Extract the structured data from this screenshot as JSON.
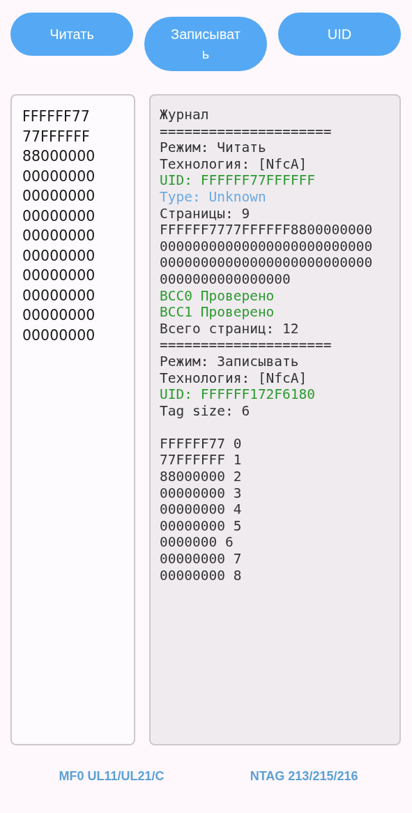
{
  "buttons": [
    {
      "label": "Читать"
    },
    {
      "label": "Записывать"
    },
    {
      "label": "UID"
    }
  ],
  "hex_field": {
    "lines": [
      "FFFFFF77",
      "77FFFFFF",
      "88000000",
      "00000000",
      "00000000",
      "00000000",
      "00000000",
      "00000000",
      "00000000",
      "00000000",
      "00000000",
      "00000000"
    ]
  },
  "log": [
    {
      "kind": "plain",
      "text": "Журнал"
    },
    {
      "kind": "plain",
      "text": "====================="
    },
    {
      "kind": "plain",
      "text": "Режим: Читать"
    },
    {
      "kind": "plain",
      "text": "Технология: [NfcA]"
    },
    {
      "kind": "success",
      "text": "UID: FFFFFF77FFFFFF"
    },
    {
      "kind": "info",
      "text": "Type: Unknown"
    },
    {
      "kind": "plain",
      "text": "Страницы: 9"
    },
    {
      "kind": "plain",
      "text": "FFFFFF7777FFFFFF8800000000"
    },
    {
      "kind": "plain",
      "text": "00000000000000000000000000"
    },
    {
      "kind": "plain",
      "text": "00000000000000000000000000"
    },
    {
      "kind": "plain",
      "text": "0000000000000000"
    },
    {
      "kind": "success",
      "text": "BCC0 Проверено"
    },
    {
      "kind": "success",
      "text": "BCC1 Проверено"
    },
    {
      "kind": "plain",
      "text": "Всего страниц: 12"
    },
    {
      "kind": "plain",
      "text": "====================="
    },
    {
      "kind": "plain",
      "text": "Режим: Записывать"
    },
    {
      "kind": "plain",
      "text": "Технология: [NfcA]"
    },
    {
      "kind": "success",
      "text": "UID: FFFFFF172F6180"
    },
    {
      "kind": "plain",
      "text": "Tag size: 6"
    },
    {
      "kind": "blank"
    },
    {
      "kind": "plain",
      "text": "FFFFFF77 0"
    },
    {
      "kind": "plain",
      "text": "77FFFFFF 1"
    },
    {
      "kind": "plain",
      "text": "88000000 2"
    },
    {
      "kind": "plain",
      "text": "00000000 3"
    },
    {
      "kind": "plain",
      "text": "00000000 4"
    },
    {
      "kind": "plain",
      "text": "00000000 5"
    },
    {
      "kind": "plain",
      "text": "0000000 6"
    },
    {
      "kind": "plain",
      "text": "00000000 7"
    },
    {
      "kind": "plain",
      "text": "00000000 8"
    }
  ],
  "footer_links": [
    "MF0 UL11/UL21/C",
    "NTAG 213/215/216"
  ]
}
